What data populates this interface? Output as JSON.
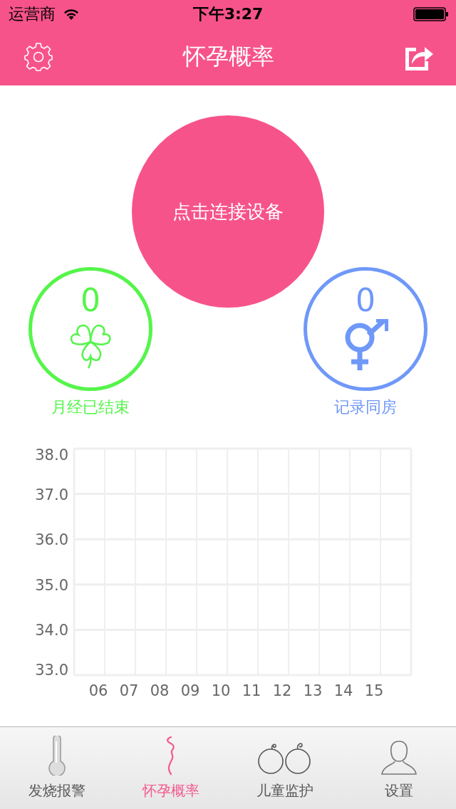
{
  "status_bar": {
    "carrier": "运营商",
    "time": "下午3:27"
  },
  "nav": {
    "title": "怀孕概率"
  },
  "connect_button": {
    "label": "点击连接设备"
  },
  "counters": [
    {
      "kind": "clover",
      "count": "0",
      "label": "月经已结束",
      "color": "#55f54a"
    },
    {
      "kind": "gender",
      "count": "0",
      "label": "记录同房",
      "color": "#6f98f8"
    }
  ],
  "chart": {
    "chart_data": {
      "type": "line",
      "grid": true,
      "categories": [
        "06",
        "07",
        "08",
        "09",
        "10",
        "11",
        "12",
        "13",
        "14",
        "15"
      ],
      "ylim": [
        33,
        38
      ],
      "yticks": [
        {
          "value": 38,
          "label": "38.0"
        },
        {
          "value": 37,
          "label": "37.0"
        },
        {
          "value": 36,
          "label": "36.0"
        },
        {
          "value": 35,
          "label": "35.0"
        },
        {
          "value": 34,
          "label": "34.0"
        },
        {
          "value": 33,
          "label": "33.0"
        }
      ]
    }
  },
  "tabs": [
    {
      "kind": "thermometer",
      "label": "发烧报警",
      "selected": false
    },
    {
      "kind": "pregnancy",
      "label": "怀孕概率",
      "selected": true
    },
    {
      "kind": "babies",
      "label": "儿童监护",
      "selected": false
    },
    {
      "kind": "person",
      "label": "设置",
      "selected": false
    }
  ]
}
